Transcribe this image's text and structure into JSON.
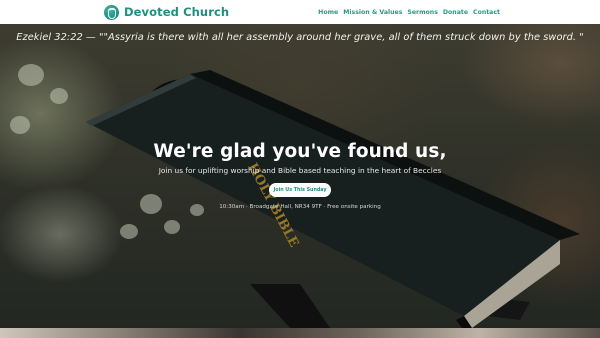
{
  "header": {
    "brand_name": "Devoted Church",
    "logo_icon": "chalice-logo-icon",
    "nav": [
      {
        "label": "Home"
      },
      {
        "label": "Mission & Values"
      },
      {
        "label": "Sermons"
      },
      {
        "label": "Donate"
      },
      {
        "label": "Contact"
      }
    ],
    "accent_color": "#1f8f80"
  },
  "hero": {
    "verse": "Ezekiel 32:22 — \"\"Assyria is there with all her assembly around her grave, all of them struck down by the sword. \"",
    "headline": "We're glad you've found us,",
    "subline": "Join us for uplifting worship and Bible based teaching in the heart of Beccles",
    "cta_label": "Join Us This Sunday",
    "meta": "10:30am · Broadgate Hall, NR34 9TF · Free onsite parking",
    "book_spine_text": "HOLY BIBLE"
  }
}
